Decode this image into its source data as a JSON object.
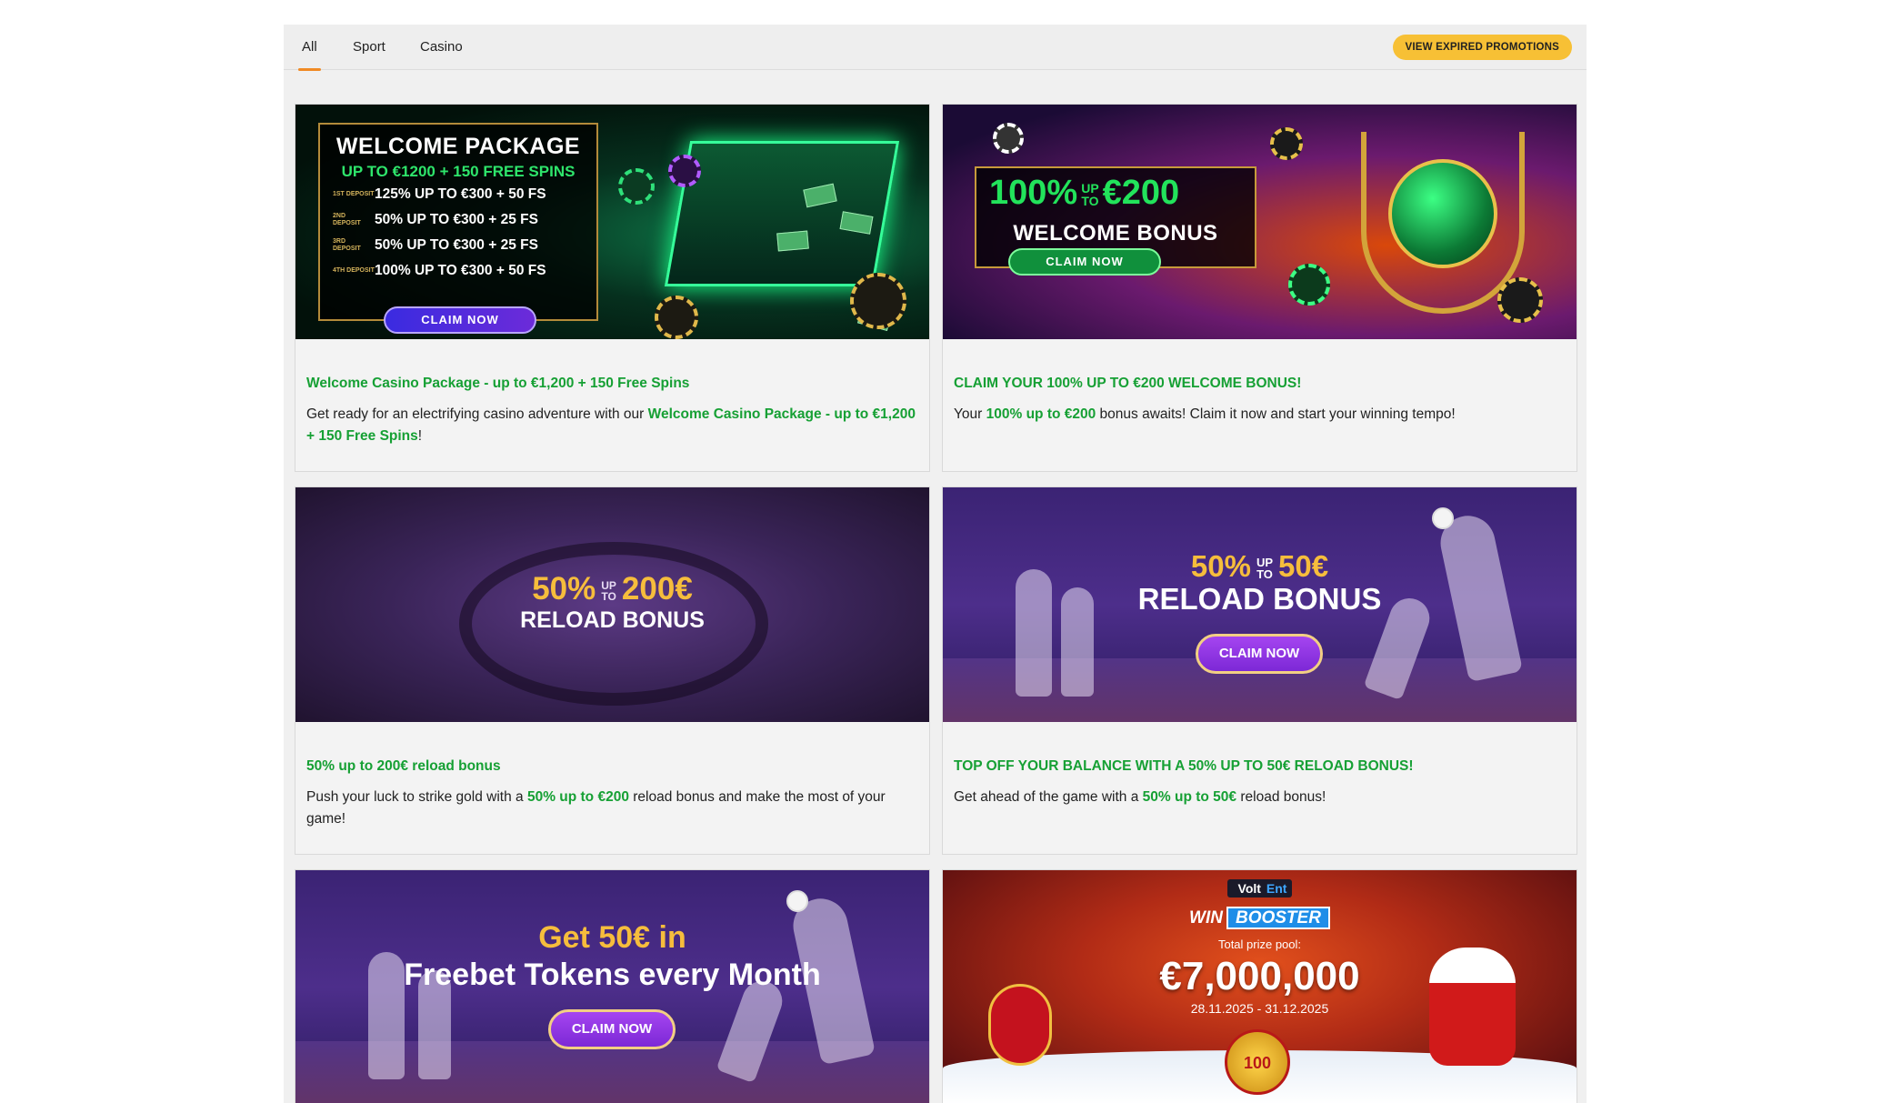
{
  "tabs": [
    {
      "label": "All",
      "active": true
    },
    {
      "label": "Sport",
      "active": false
    },
    {
      "label": "Casino",
      "active": false
    }
  ],
  "expired_button": "VIEW EXPIRED PROMOTIONS",
  "colors": {
    "accent": "#f7c035",
    "tab_underline": "#f08a24",
    "highlight": "#16a034"
  },
  "promotions": [
    {
      "banner": {
        "title": "WELCOME PACKAGE",
        "subtitle": "UP TO €1200 + 150 FREE SPINS",
        "rows": [
          {
            "tag": "1ST DEPOSIT",
            "text": "125% UP TO €300 + 50 FS"
          },
          {
            "tag": "2ND DEPOSIT",
            "text": "50% UP TO €300 + 25 FS"
          },
          {
            "tag": "3RD DEPOSIT",
            "text": "50% UP TO €300 + 25 FS"
          },
          {
            "tag": "4TH DEPOSIT",
            "text": "100% UP TO €300 + 50 FS"
          }
        ],
        "cta": "CLAIM NOW"
      },
      "title": "Welcome Casino Package - up to €1,200 + 150 Free Spins",
      "desc_pre": "Get ready for an electrifying casino adventure with our ",
      "desc_hl": "Welcome Casino Package - up to €1,200 + 150 Free Spins",
      "desc_post": "!"
    },
    {
      "banner": {
        "pct": "100%",
        "up": "UP",
        "to": "TO",
        "amount": "€200",
        "label": "WELCOME BONUS",
        "cta": "CLAIM NOW"
      },
      "title": "CLAIM YOUR 100% UP TO €200 WELCOME BONUS!",
      "desc_pre": "Your ",
      "desc_hl": "100% up to €200",
      "desc_post": " bonus awaits! Claim it now and start your winning tempo!"
    },
    {
      "banner": {
        "pct": "50%",
        "up": "UP",
        "to": "TO",
        "amount": "200€",
        "label": "RELOAD BONUS"
      },
      "title": "50% up to 200€ reload bonus",
      "desc_pre": "Push your luck to strike gold with a ",
      "desc_hl": "50% up to €200",
      "desc_post": " reload bonus and make the most of your game!"
    },
    {
      "banner": {
        "pct": "50%",
        "up": "UP",
        "to": "TO",
        "amount": "50€",
        "label": "RELOAD BONUS",
        "cta": "CLAIM NOW"
      },
      "title": "TOP OFF YOUR BALANCE WITH A 50% UP TO 50€ RELOAD BONUS!",
      "desc_pre": "Get ahead of the game with a ",
      "desc_hl": "50% up to 50€",
      "desc_post": " reload bonus!"
    },
    {
      "banner": {
        "line1": "Get 50€ in",
        "line2": "Freebet Tokens every Month",
        "cta": "CLAIM NOW"
      }
    },
    {
      "banner": {
        "brand_a": "Volt",
        "brand_b": "Ent",
        "win": "WIN",
        "booster": "BOOSTER",
        "pool_label": "Total prize pool:",
        "amount": "€7,000,000",
        "dates": "28.11.2025 - 31.12.2025",
        "coin": "100"
      }
    }
  ]
}
